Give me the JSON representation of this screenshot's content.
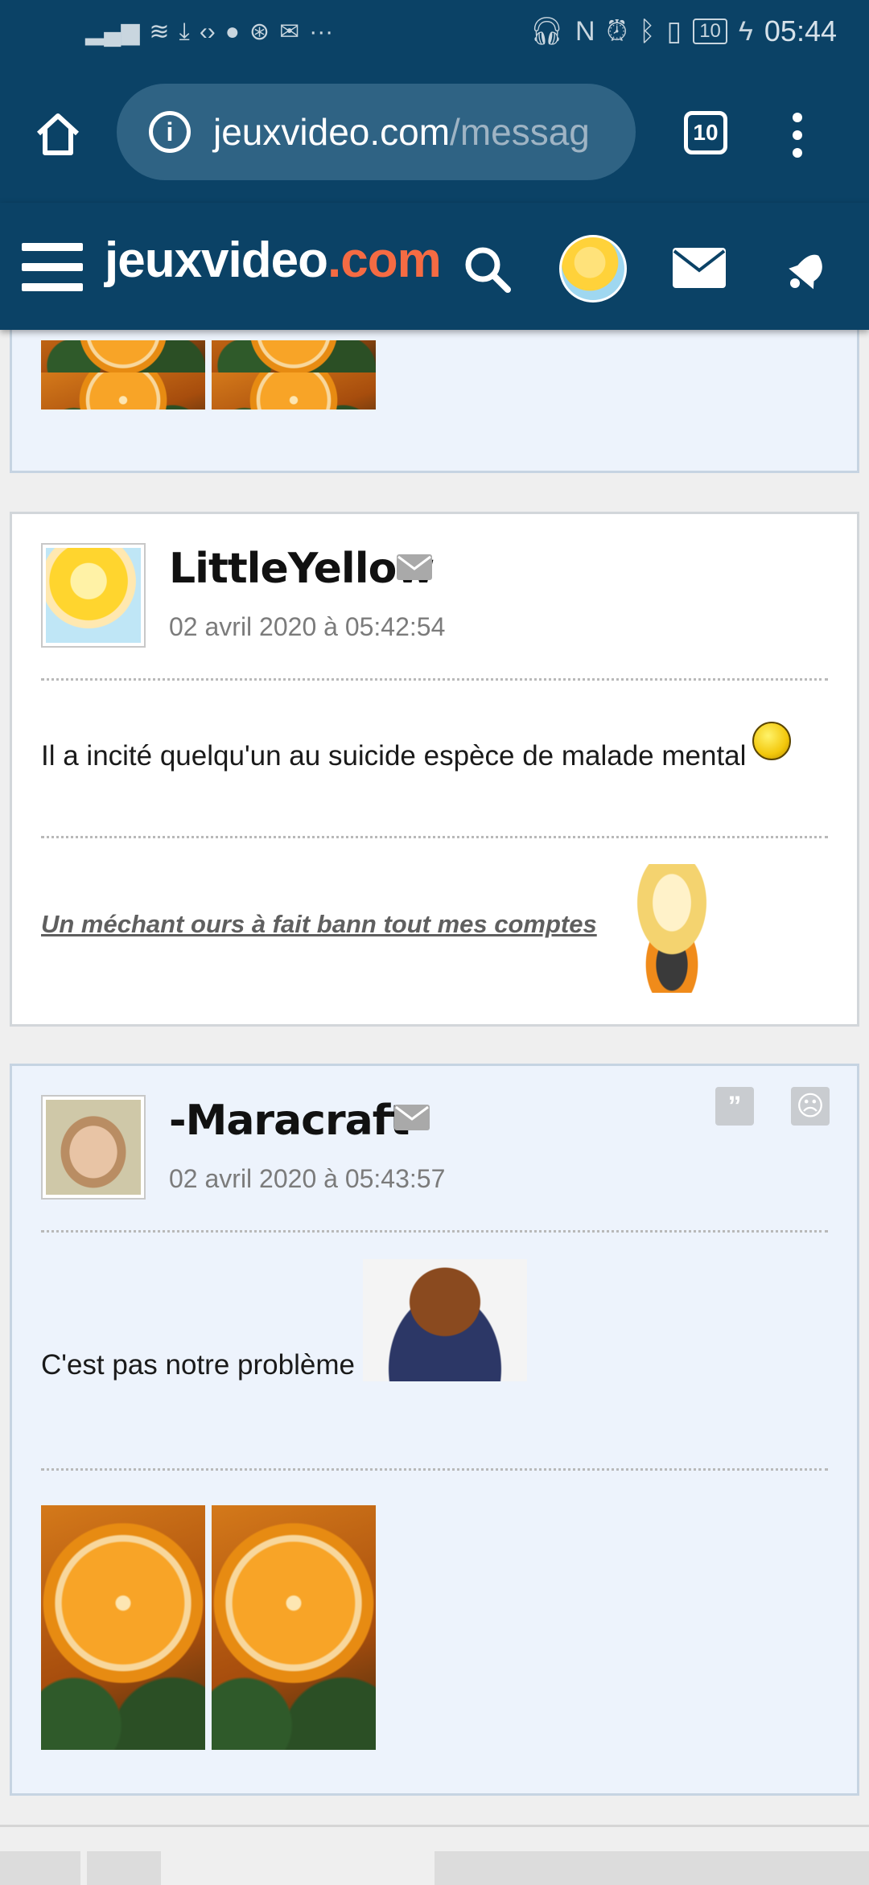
{
  "status_bar": {
    "left_icons": [
      "signal-icon",
      "wifi-icon",
      "download-icon",
      "code-icon",
      "record-icon",
      "shield-icon",
      "mail-icon"
    ],
    "more": "···",
    "battery": "10",
    "time": "05:44"
  },
  "browser": {
    "url_host": "jeuxvideo.com",
    "url_path": "/messag",
    "tabs_count": "10"
  },
  "site": {
    "logo_main": "jeuxvideo",
    "logo_suffix": ".com"
  },
  "posts": [
    {
      "author": "LittleYellow",
      "date": "02 avril 2020 à 05:42:54",
      "message": "Il a incité quelqu'un au suicide espèce de malade mental",
      "signature": "Un méchant ours à fait bann tout mes comptes"
    },
    {
      "author": "-Maracraft-",
      "date": "02 avril 2020 à 05:43:57",
      "message": "C'est pas notre problème"
    }
  ],
  "colors": {
    "header_bg": "#0b4266",
    "logo_accent": "#f56b43",
    "post_alt_bg": "#edf3fc"
  }
}
